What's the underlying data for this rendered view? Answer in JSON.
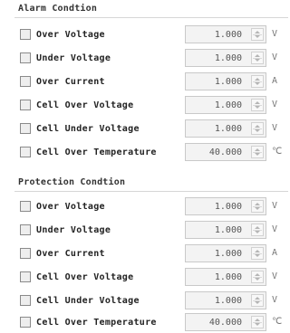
{
  "alarm": {
    "title": "Alarm Condtion",
    "rows": [
      {
        "label": "Over Voltage",
        "value": "1.000",
        "unit": "V"
      },
      {
        "label": "Under Voltage",
        "value": "1.000",
        "unit": "V"
      },
      {
        "label": "Over Current",
        "value": "1.000",
        "unit": "A"
      },
      {
        "label": "Cell Over Voltage",
        "value": "1.000",
        "unit": "V"
      },
      {
        "label": "Cell Under Voltage",
        "value": "1.000",
        "unit": "V"
      },
      {
        "label": "Cell Over Temperature",
        "value": "40.000",
        "unit": "℃"
      }
    ]
  },
  "protection": {
    "title": "Protection Condtion",
    "rows": [
      {
        "label": "Over Voltage",
        "value": "1.000",
        "unit": "V"
      },
      {
        "label": "Under Voltage",
        "value": "1.000",
        "unit": "V"
      },
      {
        "label": "Over Current",
        "value": "1.000",
        "unit": "A"
      },
      {
        "label": "Cell Over Voltage",
        "value": "1.000",
        "unit": "V"
      },
      {
        "label": "Cell Under Voltage",
        "value": "1.000",
        "unit": "V"
      },
      {
        "label": "Cell Over Temperature",
        "value": "40.000",
        "unit": "℃"
      }
    ]
  }
}
